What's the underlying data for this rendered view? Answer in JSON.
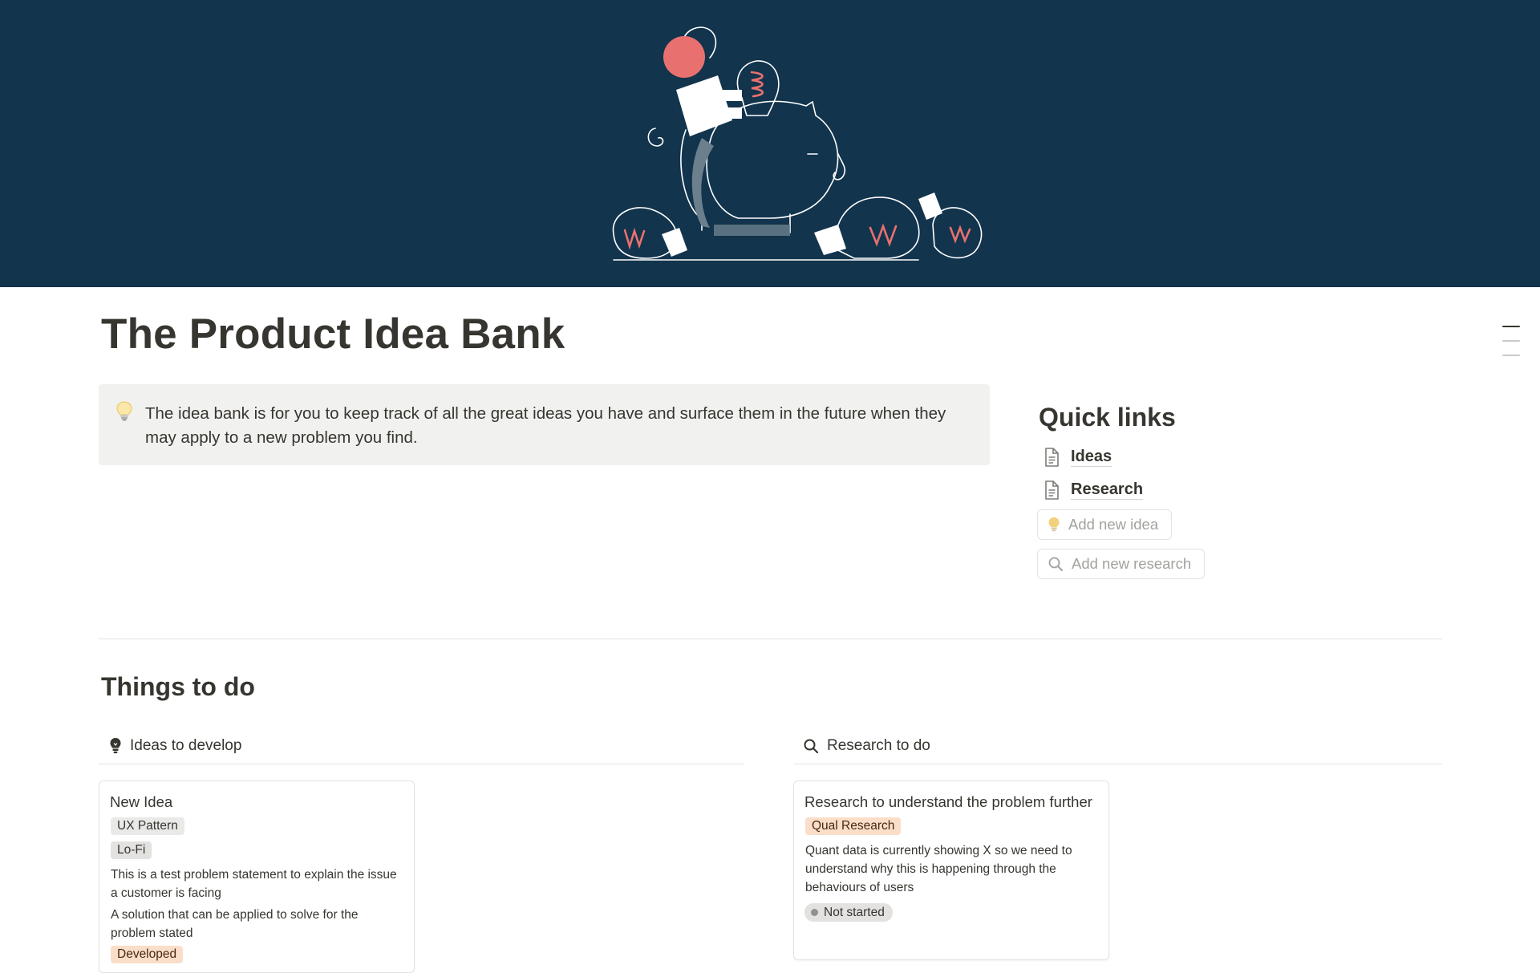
{
  "page": {
    "title": "The Product Idea Bank"
  },
  "callout": {
    "icon": "lightbulb-icon",
    "text": "The idea bank is for you to keep track of all the great ideas you have and surface them in the future when they may apply to a new problem you find."
  },
  "quick_links": {
    "heading": "Quick links",
    "links": [
      {
        "label": "Ideas",
        "icon": "page-icon"
      },
      {
        "label": "Research",
        "icon": "page-icon"
      }
    ],
    "buttons": [
      {
        "label": "Add new idea",
        "icon": "lightbulb-icon"
      },
      {
        "label": "Add new research",
        "icon": "search-icon"
      }
    ]
  },
  "things_to_do": {
    "heading": "Things to do",
    "ideas_view": {
      "title": "Ideas to develop",
      "icon": "lightbulb-icon",
      "cards": [
        {
          "title": "New Idea",
          "tags": [
            "UX Pattern",
            "Lo-Fi"
          ],
          "problem": "This is a test problem statement to explain the issue a customer is facing",
          "solution": "A solution that can be applied to solve for the problem stated",
          "status": "Developed"
        }
      ]
    },
    "research_view": {
      "title": "Research to do",
      "icon": "search-icon",
      "cards": [
        {
          "title": "Research to understand the problem further",
          "tag": "Qual Research",
          "description": "Quant data is currently showing X so we need to understand why this is happening through the behaviours of users",
          "status": "Not started"
        }
      ]
    }
  },
  "colors": {
    "cover_bg": "#12344d",
    "text": "#37352f",
    "callout_bg": "#f1f1ef",
    "accent_pink": "#e8716f"
  }
}
